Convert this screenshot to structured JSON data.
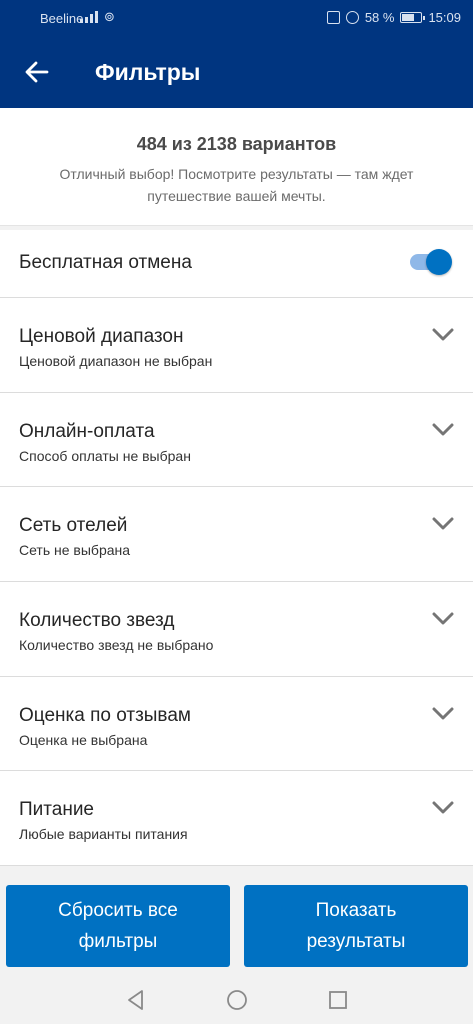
{
  "status_bar": {
    "carrier": "Beeline",
    "battery": "58 %",
    "time": "15:09"
  },
  "header": {
    "title": "Фильтры",
    "back_icon": "arrow-left-icon"
  },
  "summary": {
    "count": "484 из 2138 вариантов",
    "message": "Отличный выбор! Посмотрите результаты — там ждет путешествие вашей мечты."
  },
  "free_cancellation": {
    "label": "Бесплатная отмена",
    "enabled": true,
    "accent": "#0071c2"
  },
  "filters": [
    {
      "title": "Ценовой диапазон",
      "subtitle": "Ценовой диапазон не выбран"
    },
    {
      "title": "Онлайн-оплата",
      "subtitle": "Способ оплаты не выбран"
    },
    {
      "title": "Сеть отелей",
      "subtitle": "Сеть не выбрана"
    },
    {
      "title": "Количество звезд",
      "subtitle": "Количество звезд не выбрано"
    },
    {
      "title": "Оценка по отзывам",
      "subtitle": "Оценка не выбрана"
    },
    {
      "title": "Питание",
      "subtitle": "Любые варианты питания"
    }
  ],
  "actions": {
    "reset_label": "Сбросить все фильтры",
    "show_label": "Показать результаты"
  },
  "colors": {
    "header_bg": "#003580",
    "button_bg": "#0071c2"
  }
}
